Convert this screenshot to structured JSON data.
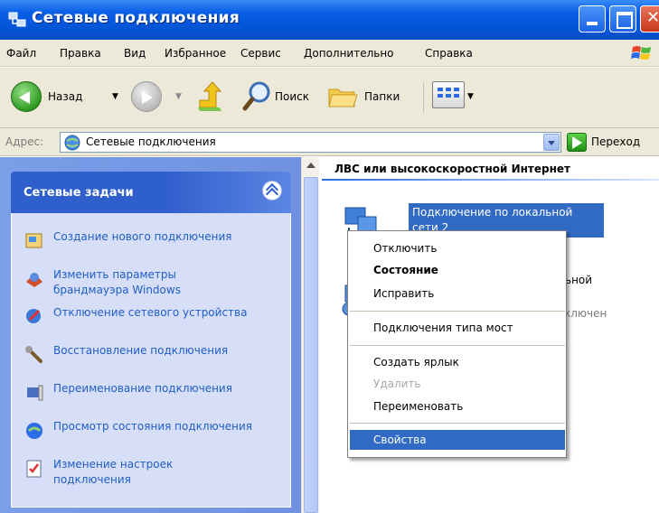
{
  "window": {
    "title": "Сетевые подключения",
    "colors": {
      "title_bar": "#0355d8",
      "selection": "#316ac5",
      "link": "#215dc6"
    }
  },
  "menu": {
    "items": [
      "Файл",
      "Правка",
      "Вид",
      "Избранное",
      "Сервис",
      "Дополнительно",
      "Справка"
    ]
  },
  "toolbar": {
    "back_label": "Назад",
    "search_label": "Поиск",
    "folders_label": "Папки"
  },
  "address": {
    "label": "Адрес:",
    "value": "Сетевые подключения",
    "go_label": "Переход"
  },
  "tasks": {
    "title": "Сетевые задачи",
    "items": [
      {
        "label": "Создание нового подключения",
        "icon": "new-connection-icon"
      },
      {
        "label": "Изменить параметры брандмауэра Windows",
        "icon": "firewall-icon"
      },
      {
        "label": "Отключение сетевого устройства",
        "icon": "disable-device-icon"
      },
      {
        "label": "Восстановление подключения",
        "icon": "repair-icon"
      },
      {
        "label": "Переименование подключения",
        "icon": "rename-icon"
      },
      {
        "label": "Просмотр состояния подключения",
        "icon": "status-icon"
      },
      {
        "label": "Изменение настроек подключения",
        "icon": "settings-icon"
      }
    ]
  },
  "content": {
    "group_header": "ЛВС или высокоскоростной Интернет",
    "selected_item": "Подключение по локальной сети 2",
    "item2_partial": "ьной",
    "item2_status_partial": "ключен"
  },
  "context_menu": {
    "items": [
      {
        "label": "Отключить",
        "state": "normal"
      },
      {
        "label": "Состояние",
        "state": "bold"
      },
      {
        "label": "Исправить",
        "state": "normal"
      },
      {
        "label": "Подключения типа мост",
        "state": "normal"
      },
      {
        "label": "Создать ярлык",
        "state": "normal"
      },
      {
        "label": "Удалить",
        "state": "disabled"
      },
      {
        "label": "Переименовать",
        "state": "normal"
      },
      {
        "label": "Свойства",
        "state": "selected"
      }
    ]
  }
}
